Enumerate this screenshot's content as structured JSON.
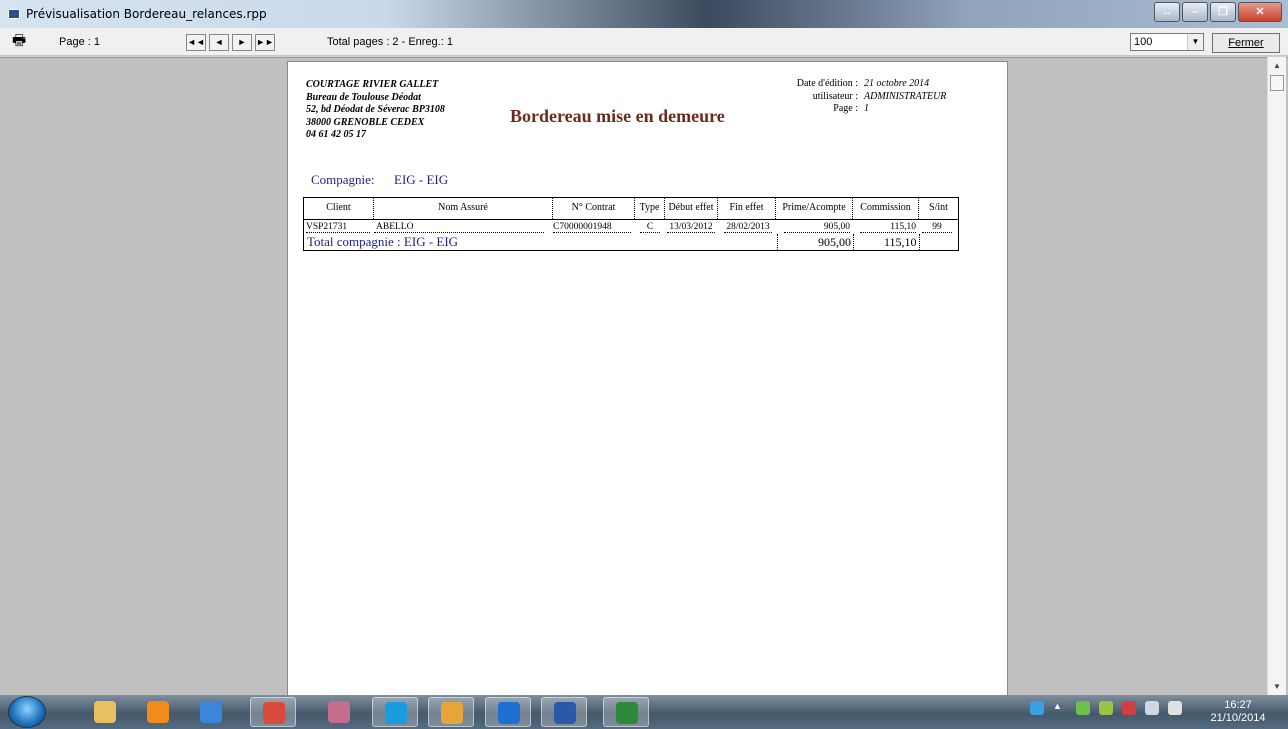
{
  "window": {
    "title": "Prévisualisation Bordereau_relances.rpp"
  },
  "toolbar": {
    "page_label": "Page : 1",
    "total_label": "Total pages : 2 - Enreg.: 1",
    "zoom_value": "100",
    "close_label": "Fermer",
    "nav": [
      {
        "name": "first-page-button",
        "icon": "first-page-icon",
        "glyph": "◄◄"
      },
      {
        "name": "prev-page-button",
        "icon": "prev-page-icon",
        "glyph": "◄"
      },
      {
        "name": "next-page-button",
        "icon": "next-page-icon",
        "glyph": "►"
      },
      {
        "name": "last-page-button",
        "icon": "last-page-icon",
        "glyph": "►►"
      }
    ]
  },
  "report": {
    "company_lines": [
      "COURTAGE RIVIER GALLET",
      "Bureau de Toulouse Déodat",
      "52, bd Déodat de Séverac BP3108",
      "38000 GRENOBLE CEDEX",
      "04 61 42 05 17"
    ],
    "title": "Bordereau mise en demeure",
    "meta": {
      "date_label": "Date d'édition :",
      "date_value": "21 octobre 2014",
      "user_label": "utilisateur :",
      "user_value": "ADMINISTRATEUR",
      "page_label": "Page :",
      "page_value": "1"
    },
    "compagnie_label": "Compagnie:",
    "compagnie_value": "EIG - EIG",
    "columns": [
      "Client",
      "Nom Assuré",
      "N° Contrat",
      "Type",
      "Début effet",
      "Fin effet",
      "Prime/Acompte",
      "Commission",
      "S/int"
    ],
    "rows": [
      [
        "VSP21731",
        "ABELLO",
        "C70000001948",
        "C",
        "13/03/2012",
        "28/02/2013",
        "905,00",
        "115,10",
        "99"
      ]
    ],
    "total_label": "Total compagnie : EIG - EIG",
    "total_prime": "905,00",
    "total_commission": "115,10"
  },
  "taskbar": {
    "time": "16:27",
    "date": "21/10/2014",
    "apps": [
      {
        "name": "file-explorer-icon",
        "color": "#e8c060"
      },
      {
        "name": "media-player-icon",
        "color": "#f28a1d"
      },
      {
        "name": "internet-explorer-icon",
        "color": "#3a86d8"
      },
      {
        "name": "chrome-icon",
        "color": "#d94a3a",
        "active": true
      },
      {
        "name": "paint-icon",
        "color": "#c46d8c"
      },
      {
        "name": "skype-icon",
        "color": "#1a9be0",
        "active": true
      },
      {
        "name": "outlook-icon",
        "color": "#e6a43a",
        "active": true
      },
      {
        "name": "teamviewer-icon",
        "color": "#1f6fd0",
        "active": true
      },
      {
        "name": "word-icon",
        "color": "#2b58a8",
        "active": true
      },
      {
        "name": "globe-app-icon",
        "color": "#2e8a3a",
        "active": true
      }
    ]
  }
}
